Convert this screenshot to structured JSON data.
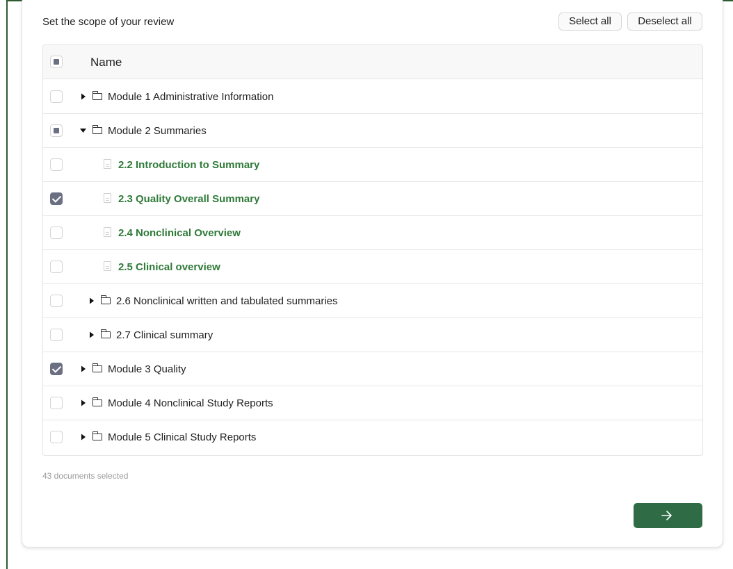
{
  "scope": {
    "title": "Set the scope of your review",
    "select_all_label": "Select all",
    "deselect_all_label": "Deselect all"
  },
  "table": {
    "header_label": "Name",
    "rows": [
      {
        "label": "Module 1 Administrative Information",
        "kind": "folder",
        "level": 0,
        "state": "unchecked",
        "expanded": false
      },
      {
        "label": "Module 2 Summaries",
        "kind": "folder",
        "level": 0,
        "state": "partial",
        "expanded": true
      },
      {
        "label": "2.2 Introduction to Summary",
        "kind": "document",
        "level": 1,
        "state": "unchecked"
      },
      {
        "label": "2.3 Quality Overall Summary",
        "kind": "document",
        "level": 1,
        "state": "checked"
      },
      {
        "label": "2.4 Nonclinical Overview",
        "kind": "document",
        "level": 1,
        "state": "unchecked"
      },
      {
        "label": "2.5 Clinical overview",
        "kind": "document",
        "level": 1,
        "state": "unchecked"
      },
      {
        "label": "2.6 Nonclinical written and tabulated summaries",
        "kind": "folder",
        "level": 1,
        "state": "unchecked",
        "expanded": false
      },
      {
        "label": "2.7 Clinical summary",
        "kind": "folder",
        "level": 1,
        "state": "unchecked",
        "expanded": false
      },
      {
        "label": "Module 3 Quality",
        "kind": "folder",
        "level": 0,
        "state": "checked",
        "expanded": false
      },
      {
        "label": "Module 4 Nonclinical Study Reports",
        "kind": "folder",
        "level": 0,
        "state": "unchecked",
        "expanded": false
      },
      {
        "label": "Module 5 Clinical Study Reports",
        "kind": "folder",
        "level": 0,
        "state": "unchecked",
        "expanded": false
      }
    ]
  },
  "footer": {
    "selected_count": "43 documents selected"
  },
  "icons": {
    "next": "arrow-right-icon",
    "folder": "folder-icon",
    "document": "document-icon",
    "expand": "caret-right-icon",
    "collapse": "caret-down-icon"
  },
  "colors": {
    "accent": "#2f6b45",
    "document_link": "#2f7a39",
    "checkbox_checked": "#6b6f82",
    "frame": "#2e5a30"
  }
}
